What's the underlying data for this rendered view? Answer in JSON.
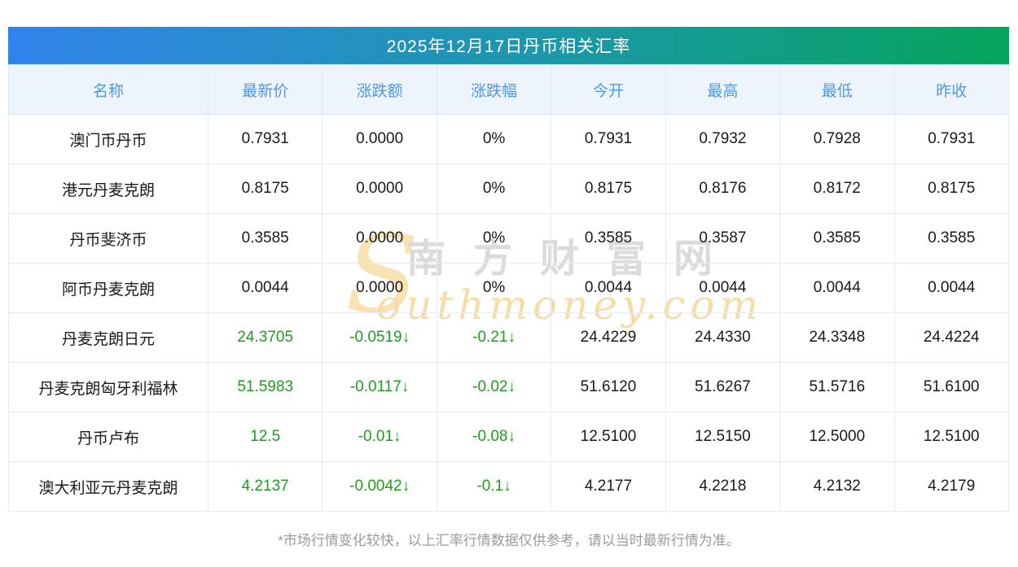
{
  "title": "2025年12月17日丹币相关汇率",
  "table": {
    "columns": [
      {
        "key": "name",
        "label": "名称"
      },
      {
        "key": "latest",
        "label": "最新价"
      },
      {
        "key": "change",
        "label": "涨跌额"
      },
      {
        "key": "change_pct",
        "label": "涨跌幅"
      },
      {
        "key": "open",
        "label": "今开"
      },
      {
        "key": "high",
        "label": "最高"
      },
      {
        "key": "low",
        "label": "最低"
      },
      {
        "key": "prev_close",
        "label": "昨收"
      }
    ],
    "rows": [
      {
        "name": "澳门币丹币",
        "latest": "0.7931",
        "change": "0.0000",
        "change_pct": "0%",
        "open": "0.7931",
        "high": "0.7932",
        "low": "0.7928",
        "prev_close": "0.7931",
        "trend": "flat"
      },
      {
        "name": "港元丹麦克朗",
        "latest": "0.8175",
        "change": "0.0000",
        "change_pct": "0%",
        "open": "0.8175",
        "high": "0.8176",
        "low": "0.8172",
        "prev_close": "0.8175",
        "trend": "flat"
      },
      {
        "name": "丹币斐济币",
        "latest": "0.3585",
        "change": "0.0000",
        "change_pct": "0%",
        "open": "0.3585",
        "high": "0.3587",
        "low": "0.3585",
        "prev_close": "0.3585",
        "trend": "flat"
      },
      {
        "name": "阿币丹麦克朗",
        "latest": "0.0044",
        "change": "0.0000",
        "change_pct": "0%",
        "open": "0.0044",
        "high": "0.0044",
        "low": "0.0044",
        "prev_close": "0.0044",
        "trend": "flat"
      },
      {
        "name": "丹麦克朗日元",
        "latest": "24.3705",
        "change": "-0.0519↓",
        "change_pct": "-0.21↓",
        "open": "24.4229",
        "high": "24.4330",
        "low": "24.3348",
        "prev_close": "24.4224",
        "trend": "down"
      },
      {
        "name": "丹麦克朗匈牙利福林",
        "latest": "51.5983",
        "change": "-0.0117↓",
        "change_pct": "-0.02↓",
        "open": "51.6120",
        "high": "51.6267",
        "low": "51.5716",
        "prev_close": "51.6100",
        "trend": "down"
      },
      {
        "name": "丹币卢布",
        "latest": "12.5",
        "change": "-0.01↓",
        "change_pct": "-0.08↓",
        "open": "12.5100",
        "high": "12.5150",
        "low": "12.5000",
        "prev_close": "12.5100",
        "trend": "down"
      },
      {
        "name": "澳大利亚元丹麦克朗",
        "latest": "4.2137",
        "change": "-0.0042↓",
        "change_pct": "-0.1↓",
        "open": "4.2177",
        "high": "4.2218",
        "low": "4.2132",
        "prev_close": "4.2179",
        "trend": "down"
      }
    ]
  },
  "watermark": {
    "cn": "南方财富网",
    "en_initial": "S",
    "en_rest": "outhmoney.com"
  },
  "footer": {
    "note": "*市场行情变化较快，以上汇率行情数据仅供参考，请以当时最新行情为准。"
  },
  "colors": {
    "title_gradient_start": "#3183EB",
    "title_gradient_end": "#05A45C",
    "header_bg": "#EEF4FC",
    "header_text": "#4D99E8",
    "cell_text": "#1A1A1A",
    "down_green": "#1E9E1E",
    "grid_line": "#E8ECF2",
    "footer_text": "#9B9B9B",
    "watermark_cn": "#DBDBDB",
    "watermark_en": "#F7DCA6"
  }
}
